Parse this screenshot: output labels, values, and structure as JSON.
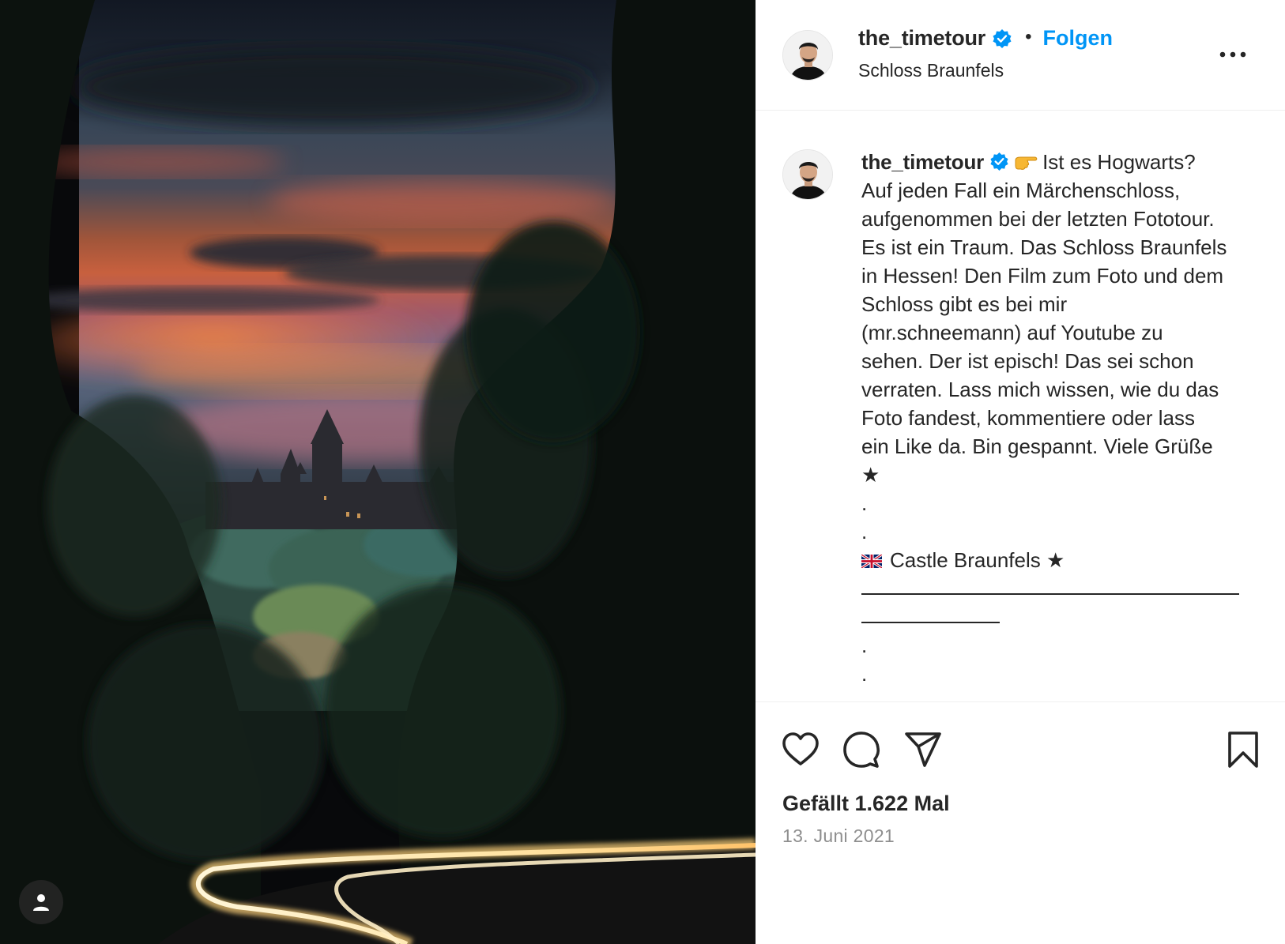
{
  "post": {
    "username": "the_timetour",
    "follow_label": "Folgen",
    "separator": "•",
    "location": "Schloss Braunfels",
    "more_label": "•••",
    "caption_lines": [
      "Auf jeden Fall ein Märchenschloss,",
      "aufgenommen bei der letzten Fototour.",
      "Es ist ein Traum. Das Schloss Braunfels",
      "in Hessen! Den Film zum Foto und dem",
      "Schloss gibt es bei mir",
      "(mr.schneemann) auf Youtube zu",
      "sehen. Der ist episch! Das sei schon",
      "verraten. Lass mich wissen, wie du das",
      "Foto fandest, kommentiere oder lass",
      "ein Like da. Bin gespannt. Viele Grüße"
    ],
    "caption_first": "Ist es Hogwarts?",
    "star": "★",
    "dot": ".",
    "english_title": "Castle Braunfels",
    "likes": "Gefällt 1.622 Mal",
    "date": "13. Juni 2021"
  },
  "icons": {
    "verified": "verified-badge-icon",
    "pointer": "backhand-index-pointing-right-icon",
    "flag": "uk-flag-icon",
    "like": "heart-icon",
    "comment": "comment-icon",
    "share": "paper-plane-icon",
    "save": "bookmark-icon",
    "tag": "user-tag-icon",
    "more": "more-options-icon"
  },
  "colors": {
    "accent": "#0095f6",
    "text": "#262626",
    "muted": "#8e8e8e",
    "border": "#efefef"
  }
}
